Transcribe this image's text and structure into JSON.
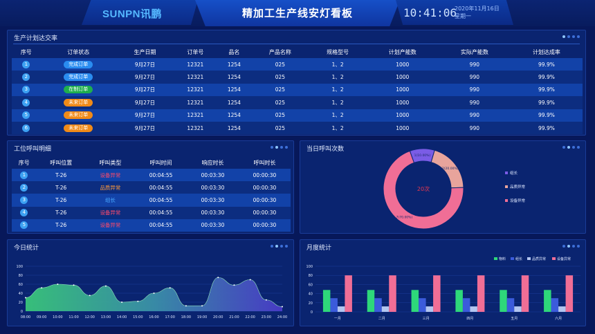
{
  "header": {
    "logo": "SUNPN讯鹏",
    "title": "精加工生产线安灯看板",
    "clock": "10:41:06",
    "date_line1": "2020年11月16日",
    "date_line2": "星期一"
  },
  "production": {
    "title": "生产计划达交率",
    "columns": [
      "序号",
      "订单状态",
      "生产日期",
      "订单号",
      "品名",
      "产品名称",
      "规格型号",
      "计划产能数",
      "实际产能数",
      "计划达成率"
    ],
    "rows": [
      {
        "no": "1",
        "status": "完成订单",
        "status_color": "#2a8cf0",
        "date": "9月27日",
        "order": "12321",
        "item": "1254",
        "product": "025",
        "spec": "1、2",
        "plan": "1000",
        "actual": "990",
        "rate": "99.9%"
      },
      {
        "no": "2",
        "status": "完成订单",
        "status_color": "#2a8cf0",
        "date": "9月27日",
        "order": "12321",
        "item": "1254",
        "product": "025",
        "spec": "1、2",
        "plan": "1000",
        "actual": "990",
        "rate": "99.9%"
      },
      {
        "no": "3",
        "status": "在制订单",
        "status_color": "#1fae4e",
        "date": "9月27日",
        "order": "12321",
        "item": "1254",
        "product": "025",
        "spec": "1、2",
        "plan": "1000",
        "actual": "990",
        "rate": "99.9%"
      },
      {
        "no": "4",
        "status": "未来订单",
        "status_color": "#f08a18",
        "date": "9月27日",
        "order": "12321",
        "item": "1254",
        "product": "025",
        "spec": "1、2",
        "plan": "1000",
        "actual": "990",
        "rate": "99.9%"
      },
      {
        "no": "5",
        "status": "未来订单",
        "status_color": "#f08a18",
        "date": "9月27日",
        "order": "12321",
        "item": "1254",
        "product": "025",
        "spec": "1、2",
        "plan": "1000",
        "actual": "990",
        "rate": "99.9%"
      },
      {
        "no": "6",
        "status": "未来订单",
        "status_color": "#f08a18",
        "date": "9月27日",
        "order": "12321",
        "item": "1254",
        "product": "025",
        "spec": "1、2",
        "plan": "1000",
        "actual": "990",
        "rate": "99.9%"
      }
    ]
  },
  "calls": {
    "title": "工位呼叫明细",
    "columns": [
      "序号",
      "呼叫位置",
      "呼叫类型",
      "呼叫时间",
      "响应时长",
      "呼叫时长"
    ],
    "rows": [
      {
        "no": "1",
        "pos": "T-26",
        "type": "设备异常",
        "type_color": "#ff4a6a",
        "time": "00:04:55",
        "resp": "00:03:30",
        "dur": "00:00:30"
      },
      {
        "no": "2",
        "pos": "T-26",
        "type": "品质异常",
        "type_color": "#ff9a3a",
        "time": "00:04:55",
        "resp": "00:03:30",
        "dur": "00:00:30"
      },
      {
        "no": "3",
        "pos": "T-26",
        "type": "组长",
        "type_color": "#4aa8ff",
        "time": "00:04:55",
        "resp": "00:03:30",
        "dur": "00:00:30"
      },
      {
        "no": "4",
        "pos": "T-26",
        "type": "设备异常",
        "type_color": "#ff4a6a",
        "time": "00:04:55",
        "resp": "00:03:30",
        "dur": "00:00:30"
      },
      {
        "no": "5",
        "pos": "T-26",
        "type": "设备异常",
        "type_color": "#ff4a6a",
        "time": "00:04:55",
        "resp": "00:03:30",
        "dur": "00:00:30"
      }
    ]
  },
  "donut": {
    "title": "当日呼叫次数",
    "center_label": "20次",
    "slices": [
      {
        "name": "组长",
        "value": 1,
        "label": "1(10.00%)",
        "color": "#7a5ce6"
      },
      {
        "name": "品质异常",
        "value": 2,
        "label": "2(20.00%)",
        "color": "#e8a49c"
      },
      {
        "name": "设备异常",
        "value": 7,
        "label": "7(70.00%)",
        "color": "#f06e96"
      }
    ]
  },
  "today": {
    "title": "今日统计",
    "x": [
      "08:00",
      "09:00",
      "10:00",
      "11:00",
      "12:00",
      "13:00",
      "14:00",
      "15:00",
      "16:00",
      "17:00",
      "18:00",
      "19:00",
      "20:00",
      "21:00",
      "22:00",
      "23:00",
      "24:00"
    ],
    "values": [
      30,
      52,
      60,
      58,
      35,
      56,
      20,
      22,
      40,
      52,
      12,
      12,
      75,
      58,
      70,
      25,
      10
    ],
    "yticks": [
      "100",
      "80",
      "60",
      "40",
      "20",
      "0"
    ]
  },
  "monthly": {
    "title": "月度统计",
    "legend": [
      {
        "name": "物料",
        "color": "#2ed87a"
      },
      {
        "name": "组长",
        "color": "#3b5bdb"
      },
      {
        "name": "品质异常",
        "color": "#b3c6f0"
      },
      {
        "name": "设备异常",
        "color": "#f06e96"
      }
    ],
    "categories": [
      "一月",
      "二月",
      "三月",
      "四月",
      "五月",
      "六月"
    ],
    "yticks": [
      "100",
      "80",
      "60",
      "40",
      "20",
      "0"
    ]
  },
  "chart_data": [
    {
      "type": "pie",
      "title": "当日呼叫次数",
      "categories": [
        "组长",
        "品质异常",
        "设备异常"
      ],
      "values": [
        1,
        2,
        7
      ]
    },
    {
      "type": "area",
      "title": "今日统计",
      "x": [
        "08:00",
        "09:00",
        "10:00",
        "11:00",
        "12:00",
        "13:00",
        "14:00",
        "15:00",
        "16:00",
        "17:00",
        "18:00",
        "19:00",
        "20:00",
        "21:00",
        "22:00",
        "23:00",
        "24:00"
      ],
      "values": [
        30,
        52,
        60,
        58,
        35,
        56,
        20,
        22,
        40,
        52,
        12,
        12,
        75,
        58,
        70,
        25,
        10
      ],
      "ylim": [
        0,
        100
      ]
    },
    {
      "type": "bar",
      "title": "月度统计",
      "categories": [
        "一月",
        "二月",
        "三月",
        "四月",
        "五月",
        "六月"
      ],
      "series": [
        {
          "name": "物料",
          "values": [
            48,
            48,
            48,
            48,
            48,
            48
          ]
        },
        {
          "name": "组长",
          "values": [
            30,
            30,
            30,
            30,
            30,
            30
          ]
        },
        {
          "name": "品质异常",
          "values": [
            12,
            12,
            12,
            12,
            12,
            12
          ]
        },
        {
          "name": "设备异常",
          "values": [
            80,
            80,
            80,
            80,
            80,
            80
          ]
        }
      ],
      "ylim": [
        0,
        100
      ]
    }
  ]
}
